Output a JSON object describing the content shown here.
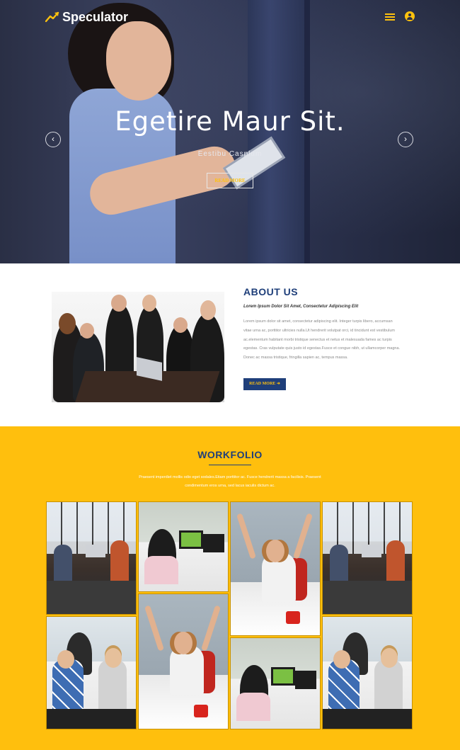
{
  "header": {
    "brand": "Speculator",
    "icons": [
      "trend-logo-icon",
      "menu-icon",
      "user-icon"
    ]
  },
  "hero": {
    "title": "Egetire Maur Sit.",
    "subtitle": "Eestibu Casplum",
    "button": "READ MORE",
    "prev_icon": "‹",
    "next_icon": "›"
  },
  "about": {
    "title": "ABOUT US",
    "lead": "Lorem Ipsum Dolor Sit Amet, Consectetur Adipiscing Elit",
    "body": "Lorem ipsum dolor sit amet, consectetur adipiscing elit. Integer turpis libero, accumsan vitae urna ac, porttitor ultricies nulla.Ut hendrerit volutpat orci, id tincidunt est vestibulum ac.elementum habitant morbi tristique senectus et netus et malesuada fames ac turpis egestas. Cras vulputate quis justo id egestas.Fusce et congue nibh, ut ullamcorper magna. Donec ac massa tristique, fringilla sapien ac, tempus massa.",
    "button": "READ MORE",
    "button_arrow": "➜"
  },
  "workfolio": {
    "title": "WORKFOLIO",
    "description": "Praesent imperdiet mollis odio eget sodales.Etiam porttitor ac. Fusce hendrerit massa a facilisis. Praesent condimentum eros urna, sed lacus iaculis dictum ac.",
    "tiles": [
      "office-meeting",
      "computer-desk",
      "cheering-woman",
      "office-meeting",
      "people-with-tablet",
      "cheering-woman",
      "computer-desk",
      "people-with-tablet"
    ]
  },
  "colors": {
    "accent": "#ffc20e",
    "navy": "#1f3f7a",
    "workfolio_bg": "#ffbf0d"
  }
}
